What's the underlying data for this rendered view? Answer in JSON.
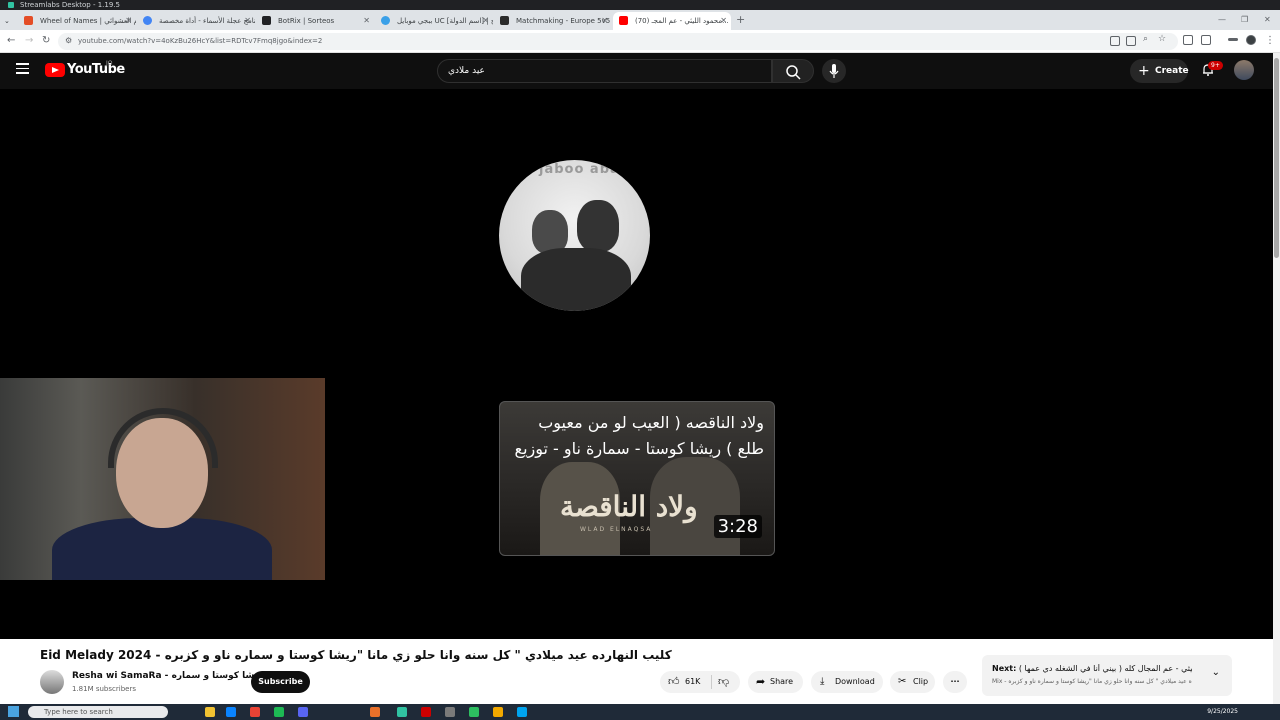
{
  "streamlabs": {
    "title": "Streamlabs Desktop - 1.19.5"
  },
  "tabs": [
    {
      "label": "Wheel of Names | اسم العشوائي"
    },
    {
      "label": "برنامج عجلة الأسماء - أداة مخصصة..."
    },
    {
      "label": "BotRix | Sorteos"
    },
    {
      "label": "ببجي موبايل UC [اسم الدولة] | ح..."
    },
    {
      "label": "Matchmaking - Europe 5v5 Qu..."
    },
    {
      "label": "(70) محمود الليثي - عم المجـ..."
    }
  ],
  "window_controls": {
    "minimize": "—",
    "restore": "❐",
    "close": "✕"
  },
  "address": {
    "url": "youtube.com/watch?v=4oKzBu26HcY&list=RDTcv7Fmq8jgo&index=2"
  },
  "youtube": {
    "logo_text": "YouTube",
    "country_code": "JO",
    "search_value": "عيد ملادي",
    "create_label": "Create",
    "notif_badge": "9+"
  },
  "player": {
    "circle_text": "jaboo aba",
    "card_title": "ولاد الناقصه ( العيب لو من معيوب طلع ) ريشا كوستا - سمارة ناو - توزيع",
    "card_logo": "ولاد الناقصة",
    "card_logo_sub": "WLAD ELNAQSA",
    "duration": "3:28"
  },
  "video": {
    "title": "Eid Melady 2024 - كليب النهارده عيد ميلادي \" كل سنه وانا حلو زي مانا \"ريشا كوستا و سماره ناو و كزبره",
    "channel_name": "Resha wi SamaRa - ريشا كوستا و سماره",
    "subscribers": "1.81M subscribers",
    "subscribe_label": "Subscribe",
    "likes": "61K",
    "share_label": "Share",
    "download_label": "Download",
    "clip_label": "Clip",
    "more_label": "···"
  },
  "next": {
    "prefix": "Next:",
    "title": "محمود الليثي - عم المجال كله ( بيني أنا في الشغله دي عمها ) [...",
    "subtitle": "Mix - كليب النهارده عيد ميلادي \" كل سنه وانا حلو زي مانا \"ريشا كوستا و سماره ناو و كزبره"
  },
  "taskbar": {
    "search_placeholder": "Type here to search",
    "date": "9/25/2025"
  },
  "colors": {
    "yt_red": "#ff0000",
    "dark_bg": "#0f0f0f",
    "tab_strip": "#dfe3e7"
  }
}
